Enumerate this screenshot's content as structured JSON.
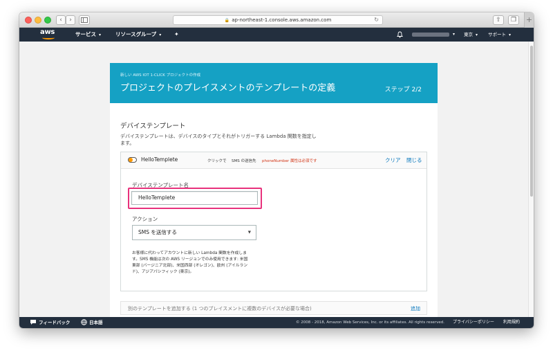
{
  "browser": {
    "url": "ap-northeast-1.console.aws.amazon.com",
    "add_tab": "+"
  },
  "awsnav": {
    "logo": "aws",
    "services": "サービス",
    "resource_groups": "リソースグループ",
    "region": "東京",
    "support": "サポート",
    "caret": "▾"
  },
  "hero": {
    "breadcrumb": "新しい AWS IOT 1-CLICK プロジェクトの作成",
    "title": "プロジェクトのプレイスメントのテンプレートの定義",
    "step": "ステップ 2/2",
    "color": "#15a1c4"
  },
  "section": {
    "title": "デバイステンプレート",
    "description": "デバイステンプレートは、デバイスのタイプとそれがトリガーする Lambda 関数を指定します。"
  },
  "card": {
    "template_name": "HelloTemplete",
    "click_text": "クリックで",
    "sms_text": "SMS の送信先",
    "warning": "phoneNumber 属性は必須です",
    "clear": "クリア",
    "close": "閉じる",
    "name_label": "デバイステンプレート名",
    "name_value": "HelloTemplete",
    "action_label": "アクション",
    "action_value": "SMS を送信する",
    "note": "お客様に代わってアカウントに新しい Lambda 関数を作成します。SMS 機能は次の AWS リージョンでのみ使用できます: 米国東部 (バージニア北部)、米国西部 (オレゴン)、欧州 (アイルランド)、アジアパシフィック (東京)。"
  },
  "add_row": {
    "text": "別のテンプレートを追加する (1 つのプレイスメントに複数のデバイスが必要な場合)",
    "link": "追加"
  },
  "footer": {
    "feedback": "フィードバック",
    "language": "日本語",
    "copyright": "© 2008 - 2018, Amazon Web Services, Inc. or its affiliates. All rights reserved.",
    "privacy": "プライバシーポリシー",
    "terms": "利用規約"
  },
  "colors": {
    "accent": "#ff9900",
    "link": "#0073bb",
    "highlight": "#e8317c",
    "warning": "#d13212",
    "nav_bg": "#232f3e"
  }
}
